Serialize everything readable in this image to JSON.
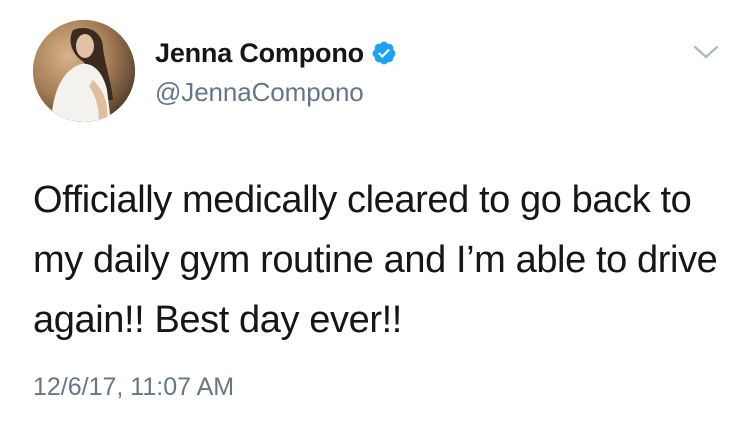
{
  "tweet": {
    "author": {
      "display_name": "Jenna Compono",
      "handle": "@JennaCompono",
      "verified": true,
      "avatar_icon": "profile-photo"
    },
    "text": "Officially medically cleared to go back to my daily gym routine and I’m able to drive again!! Best day ever!!",
    "timestamp": "12/6/17, 11:07 AM",
    "menu_icon": "chevron-down-icon"
  },
  "colors": {
    "text_primary": "#14171a",
    "text_secondary": "#657786",
    "verified_blue": "#1da1f2",
    "chevron_gray": "#aab8c2"
  }
}
